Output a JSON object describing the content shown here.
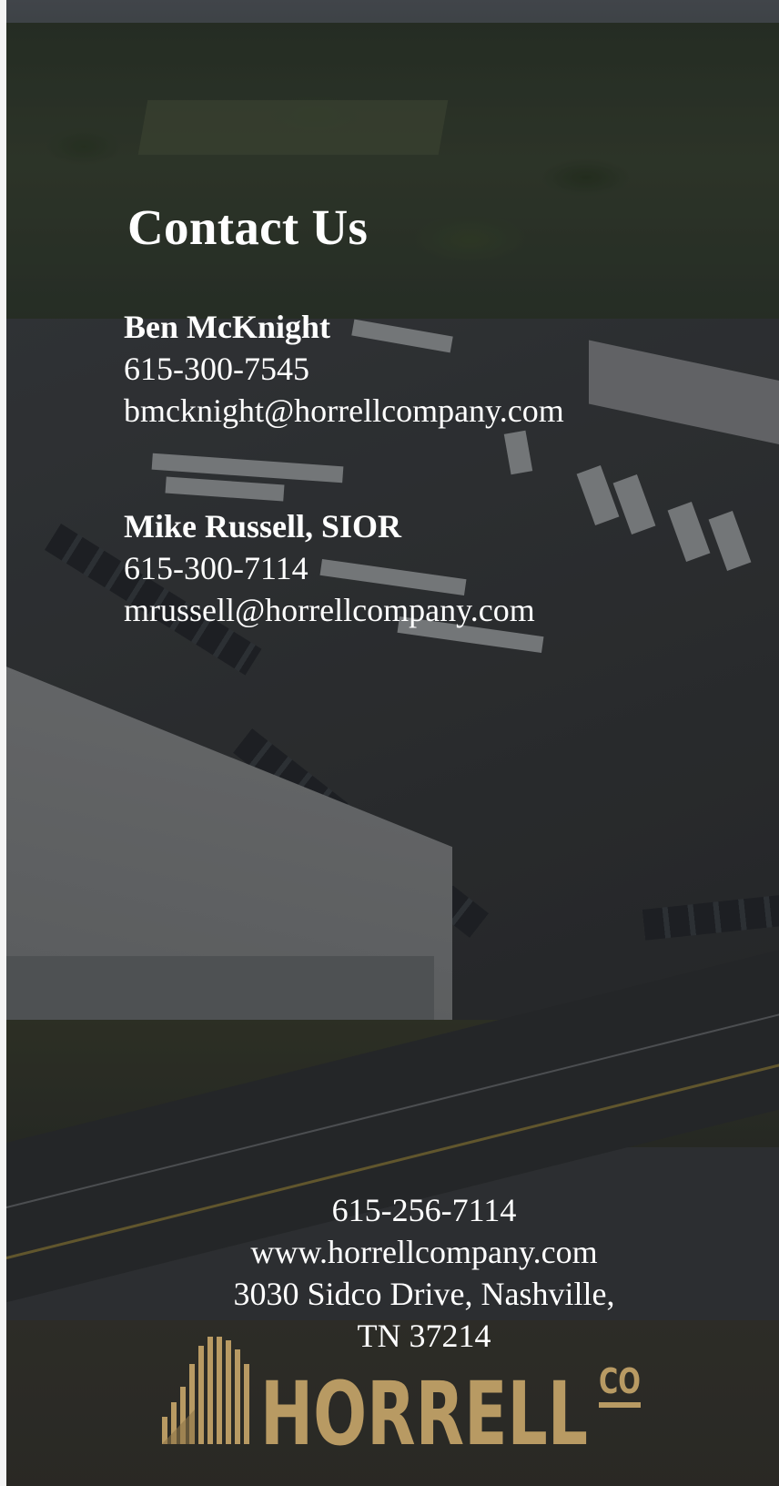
{
  "page": {
    "title": "Contact Us"
  },
  "contacts": [
    {
      "name": "Ben McKnight",
      "phone": "615-300-7545",
      "email": "bmcknight@horrellcompany.com"
    },
    {
      "name": "Mike Russell, SIOR",
      "phone": "615-300-7114",
      "email": "mrussell@horrellcompany.com"
    }
  ],
  "company": {
    "phone": "615-256-7114",
    "website": "www.horrellcompany.com",
    "address_line1": "3030 Sidco Drive, Nashville,",
    "address_line2": "TN 37214",
    "logo_text": "HORRELL",
    "logo_suffix": "CO"
  },
  "colors": {
    "text": "#ffffff",
    "logo_gold": "#b89a63",
    "overlay": "#141416"
  },
  "icons": {
    "logo_mark": "building-bars-icon"
  }
}
